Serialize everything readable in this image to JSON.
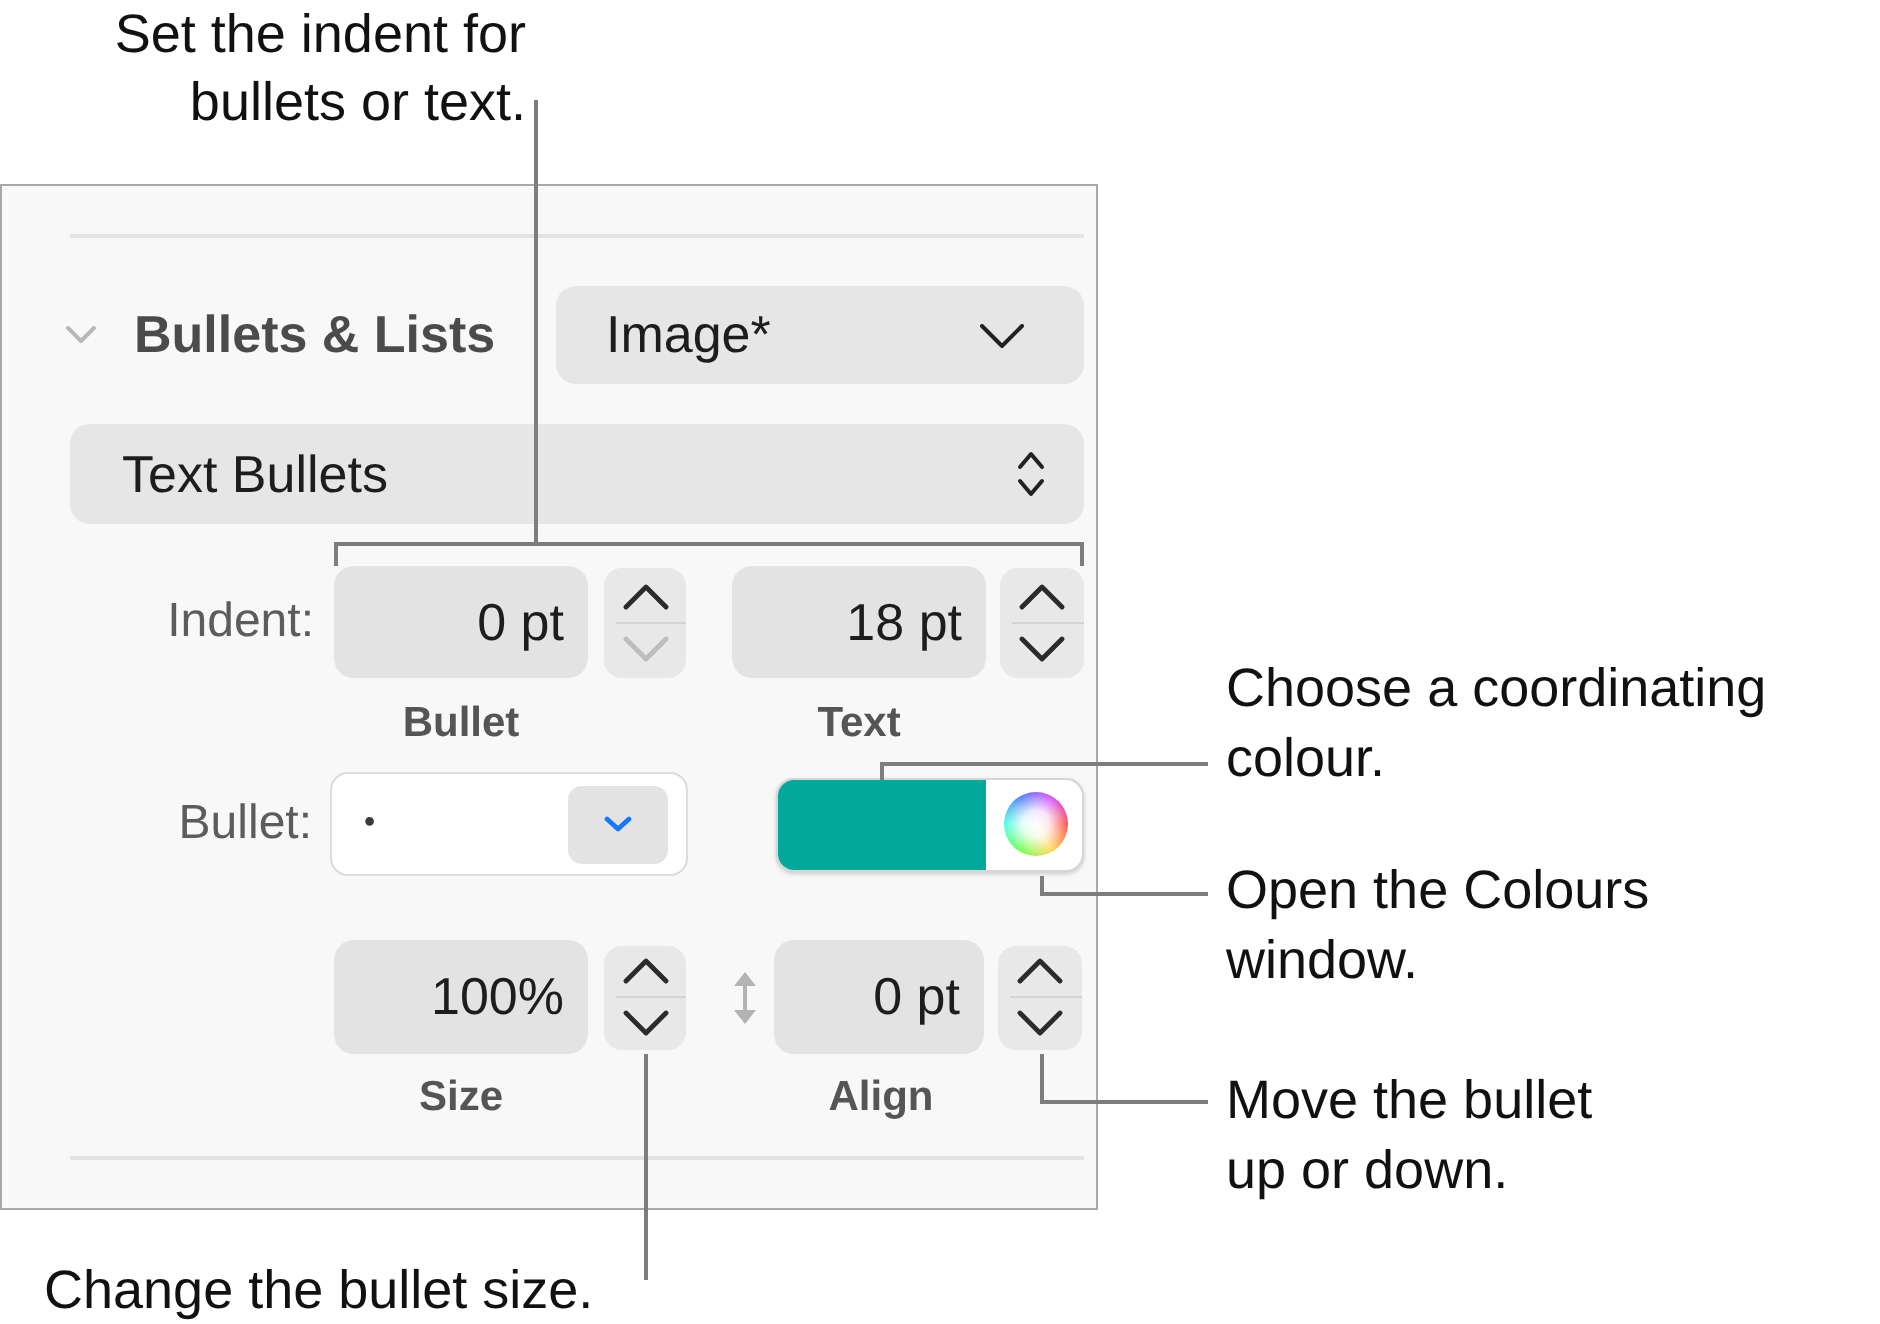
{
  "callouts": [
    {
      "text": "Set the indent for bullets or text."
    },
    {
      "text": "Choose a coordinating colour."
    },
    {
      "text": "Open the Colours window."
    },
    {
      "text": "Move the bullet up or down."
    },
    {
      "text": "Change the bullet size."
    }
  ],
  "panel": {
    "section": {
      "title": "Bullets & Lists",
      "expanded": true,
      "style": "Image*"
    },
    "list_type": "Text Bullets",
    "indent": {
      "label": "Indent:",
      "fields": [
        {
          "value": "0 pt",
          "caption": "Bullet",
          "up_disabled": false,
          "down_disabled": true
        },
        {
          "value": "18 pt",
          "caption": "Text",
          "up_disabled": false,
          "down_disabled": false
        }
      ]
    },
    "bullet": {
      "label": "Bullet:",
      "value": "•",
      "color": "#00a99a"
    },
    "size_align": {
      "fields": [
        {
          "value": "100%",
          "caption": "Size",
          "up_disabled": false,
          "down_disabled": false
        },
        {
          "value": "0 pt",
          "caption": "Align",
          "up_disabled": false,
          "down_disabled": false
        }
      ]
    }
  }
}
